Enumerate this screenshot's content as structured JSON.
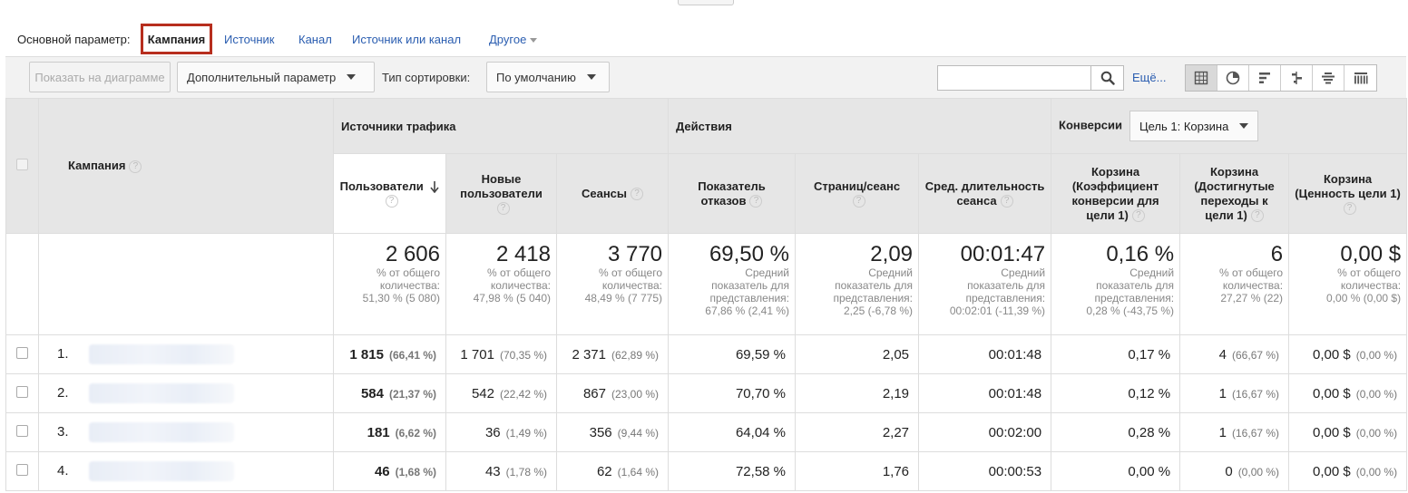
{
  "dimension_bar": {
    "label": "Основной параметр:",
    "active": "Кампания",
    "links": [
      "Источник",
      "Канал",
      "Источник или канал",
      "Другое"
    ]
  },
  "toolbar": {
    "plot_button": "Показать на диаграмме",
    "secondary_dim": "Дополнительный параметр",
    "sort_label": "Тип сортировки:",
    "sort_value": "По умолчанию",
    "search_value": "",
    "more_link": "Ещё...",
    "views": [
      "table-view-icon",
      "pie-view-icon",
      "performance-view-icon",
      "comparison-view-icon",
      "term-cloud-icon",
      "pivot-view-icon"
    ]
  },
  "table": {
    "dim_header": "Кампания",
    "groups": {
      "acquisition": "Источники трафика",
      "behavior": "Действия",
      "conversions": "Конверсии",
      "goal_select": "Цель 1: Корзина"
    },
    "columns": [
      "Пользователи",
      "Новые пользователи",
      "Сеансы",
      "Показатель отказов",
      "Страниц/сеанс",
      "Сред. длительность сеанса",
      "Корзина (Коэффициент конверсии для цели 1)",
      "Корзина (Достигнутые переходы к цели 1)",
      "Корзина (Ценность цели 1)"
    ],
    "totals": [
      {
        "value": "2 606",
        "sub": [
          "% от общего",
          "количества:",
          "51,30 % (5 080)"
        ]
      },
      {
        "value": "2 418",
        "sub": [
          "% от общего",
          "количества:",
          "47,98 % (5 040)"
        ]
      },
      {
        "value": "3 770",
        "sub": [
          "% от общего",
          "количества:",
          "48,49 % (7 775)"
        ]
      },
      {
        "value": "69,50 %",
        "sub": [
          "Средний",
          "показатель для",
          "представления:",
          "67,86 % (2,41 %)"
        ]
      },
      {
        "value": "2,09",
        "sub": [
          "Средний",
          "показатель для",
          "представления:",
          "2,25 (-6,78 %)"
        ]
      },
      {
        "value": "00:01:47",
        "sub": [
          "Средний",
          "показатель для",
          "представления:",
          "00:02:01 (-11,39 %)"
        ]
      },
      {
        "value": "0,16 %",
        "sub": [
          "Средний",
          "показатель для",
          "представления:",
          "0,28 % (-43,75 %)"
        ]
      },
      {
        "value": "6",
        "sub": [
          "% от общего",
          "количества:",
          "27,27 % (22)"
        ]
      },
      {
        "value": "0,00 $",
        "sub": [
          "% от общего",
          "количества:",
          "0,00 % (0,00 $)"
        ]
      }
    ],
    "rows": [
      {
        "idx": "1.",
        "cells": [
          [
            "1 815",
            "(66,41 %)"
          ],
          [
            "1 701",
            "(70,35 %)"
          ],
          [
            "2 371",
            "(62,89 %)"
          ],
          [
            "69,59 %",
            ""
          ],
          [
            "2,05",
            ""
          ],
          [
            "00:01:48",
            ""
          ],
          [
            "0,17 %",
            ""
          ],
          [
            "4",
            "(66,67 %)"
          ],
          [
            "0,00 $",
            "(0,00 %)"
          ]
        ]
      },
      {
        "idx": "2.",
        "cells": [
          [
            "584",
            "(21,37 %)"
          ],
          [
            "542",
            "(22,42 %)"
          ],
          [
            "867",
            "(23,00 %)"
          ],
          [
            "70,70 %",
            ""
          ],
          [
            "2,19",
            ""
          ],
          [
            "00:01:48",
            ""
          ],
          [
            "0,12 %",
            ""
          ],
          [
            "1",
            "(16,67 %)"
          ],
          [
            "0,00 $",
            "(0,00 %)"
          ]
        ]
      },
      {
        "idx": "3.",
        "cells": [
          [
            "181",
            "(6,62 %)"
          ],
          [
            "36",
            "(1,49 %)"
          ],
          [
            "356",
            "(9,44 %)"
          ],
          [
            "64,04 %",
            ""
          ],
          [
            "2,27",
            ""
          ],
          [
            "00:02:00",
            ""
          ],
          [
            "0,28 %",
            ""
          ],
          [
            "1",
            "(16,67 %)"
          ],
          [
            "0,00 $",
            "(0,00 %)"
          ]
        ]
      },
      {
        "idx": "4.",
        "cells": [
          [
            "46",
            "(1,68 %)"
          ],
          [
            "43",
            "(1,78 %)"
          ],
          [
            "62",
            "(1,64 %)"
          ],
          [
            "72,58 %",
            ""
          ],
          [
            "1,76",
            ""
          ],
          [
            "00:00:53",
            ""
          ],
          [
            "0,00 %",
            ""
          ],
          [
            "0",
            "(0,00 %)"
          ],
          [
            "0,00 $",
            "(0,00 %)"
          ]
        ]
      }
    ]
  },
  "colors": {
    "link": "#2a5db0",
    "highlight": "#b72e1e",
    "header_bg": "#e6e6e6"
  }
}
